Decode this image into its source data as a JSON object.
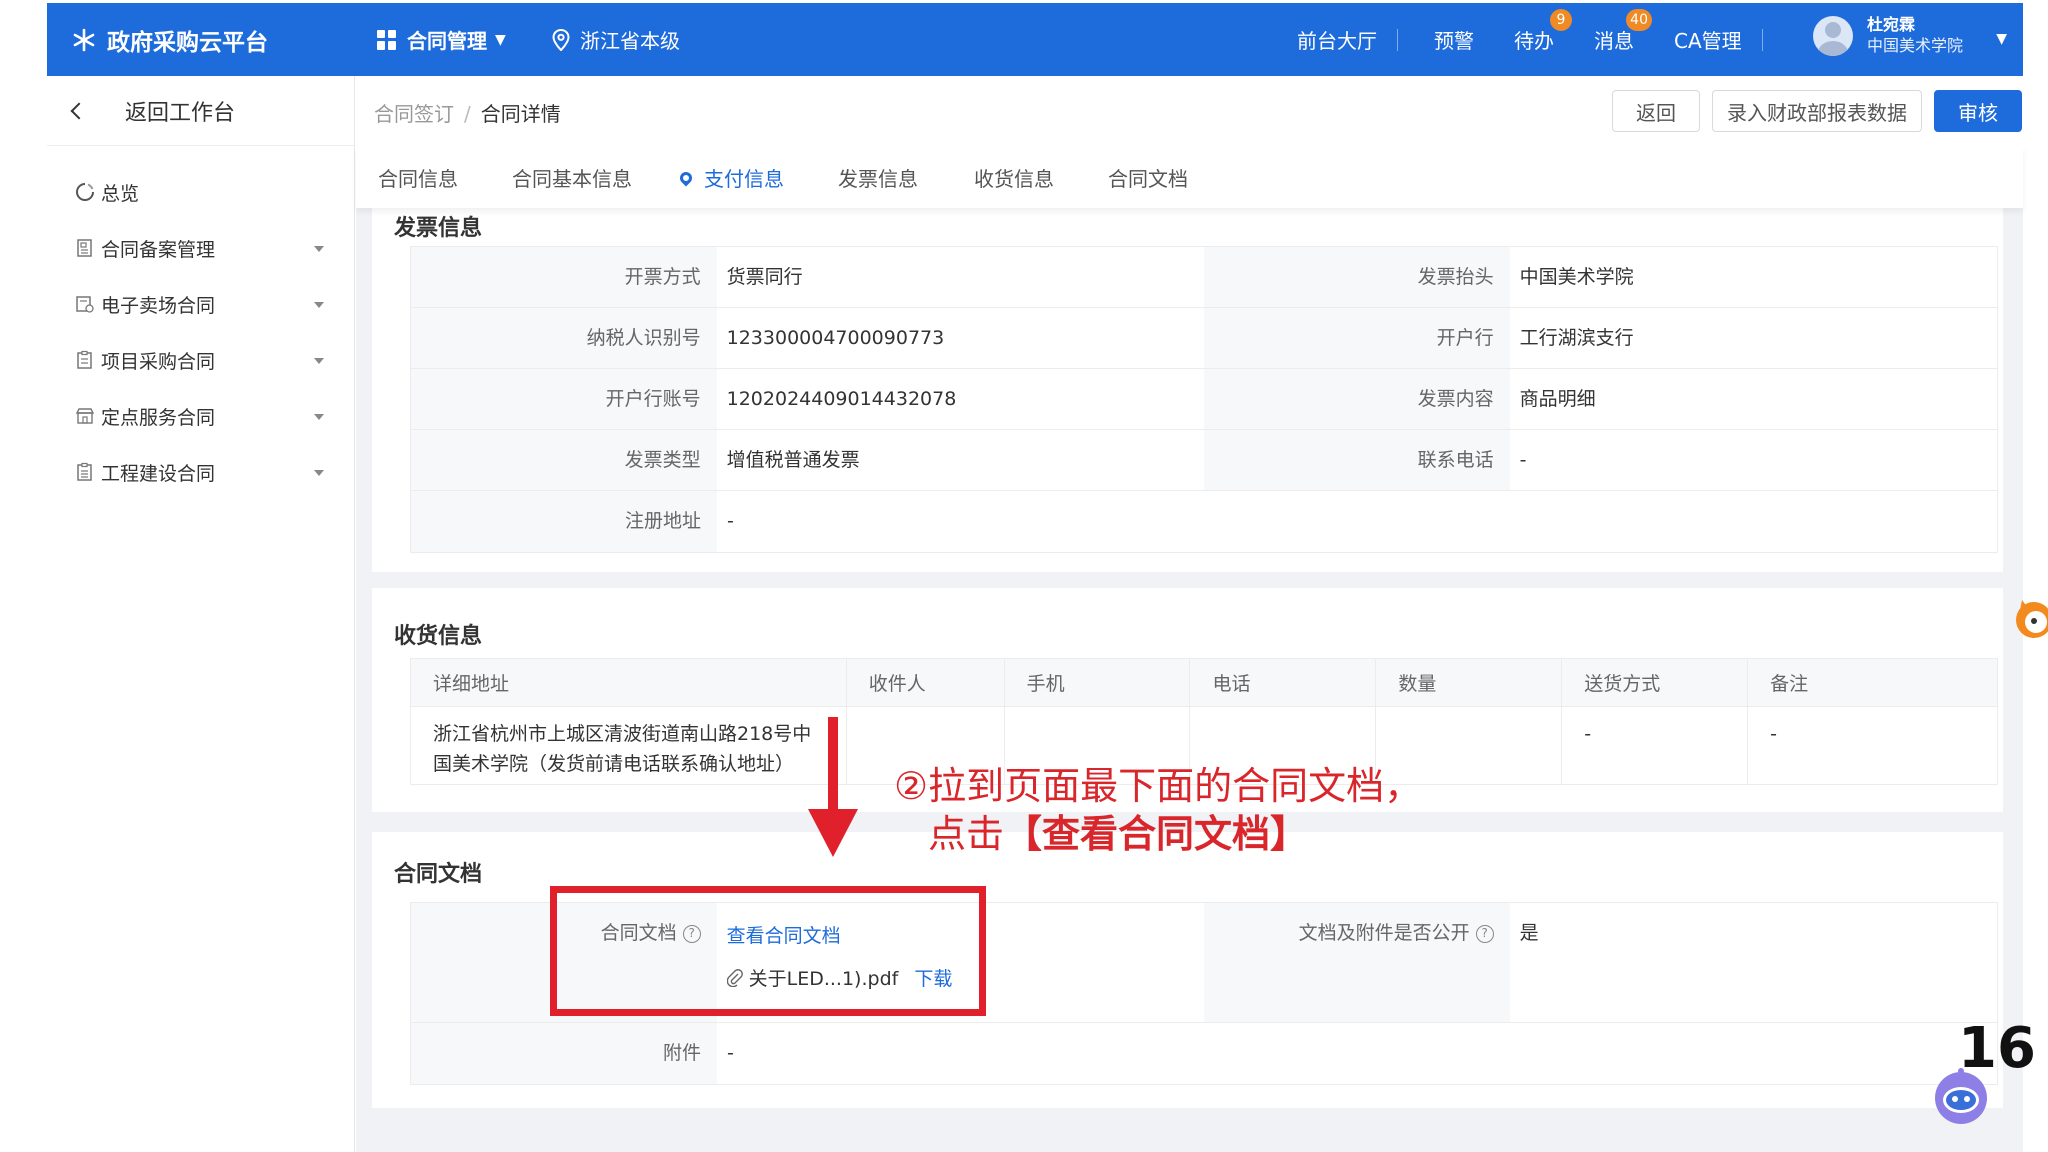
{
  "topbar": {
    "title": "政府采购云平台",
    "menu": "合同管理",
    "region": "浙江省本级",
    "nav": [
      {
        "label": "前台大厅",
        "badge": ""
      },
      {
        "label": "预警",
        "badge": ""
      },
      {
        "label": "待办",
        "badge": "9"
      },
      {
        "label": "消息",
        "badge": "40"
      },
      {
        "label": "CA管理",
        "badge": ""
      }
    ],
    "user_name": "杜宛霖",
    "user_org": "中国美术学院"
  },
  "sidebar": {
    "back": "返回工作台",
    "items": [
      {
        "label": "总览"
      },
      {
        "label": "合同备案管理"
      },
      {
        "label": "电子卖场合同"
      },
      {
        "label": "项目采购合同"
      },
      {
        "label": "定点服务合同"
      },
      {
        "label": "工程建设合同"
      }
    ]
  },
  "breadcrumb": {
    "parent": "合同签订",
    "sep": "/",
    "current": "合同详情"
  },
  "actions": {
    "back": "返回",
    "report": "录入财政部报表数据",
    "audit": "审核"
  },
  "tabs": [
    "合同信息",
    "合同基本信息",
    "支付信息",
    "发票信息",
    "收货信息",
    "合同文档"
  ],
  "invoice": {
    "title": "发票信息",
    "rows": [
      {
        "l1": "开票方式",
        "v1": "货票同行",
        "l2": "发票抬头",
        "v2": "中国美术学院"
      },
      {
        "l1": "纳税人识别号",
        "v1": "123300004700090773",
        "l2": "开户行",
        "v2": "工行湖滨支行"
      },
      {
        "l1": "开户行账号",
        "v1": "1202024409014432078",
        "l2": "发票内容",
        "v2": "商品明细"
      },
      {
        "l1": "发票类型",
        "v1": "增值税普通发票",
        "l2": "联系电话",
        "v2": "-"
      },
      {
        "l1": "注册地址",
        "v1": "-"
      }
    ]
  },
  "delivery": {
    "title": "收货信息",
    "headers": [
      "详细地址",
      "收件人",
      "手机",
      "电话",
      "数量",
      "送货方式",
      "备注"
    ],
    "row": {
      "address": "浙江省杭州市上城区清波街道南山路218号中国美术学院（发货前请电话联系确认地址）",
      "recipient": "",
      "mobile": "",
      "phone": "",
      "qty": "",
      "method": "-",
      "note": "-"
    }
  },
  "docs": {
    "title": "合同文档",
    "label": "合同文档",
    "view_link": "查看合同文档",
    "file": "关于LED...1).pdf",
    "download": "下载",
    "public_label": "文档及附件是否公开",
    "public_value": "是",
    "attach_label": "附件",
    "attach_value": "-"
  },
  "annotation": {
    "line1": "②拉到页面最下面的合同文档，",
    "line2_prefix": "点击",
    "line2_bold": "【查看合同文档】"
  },
  "page_number": "16",
  "colors": {
    "primary": "#1e6bdb",
    "annotation": "#e0202a",
    "badge": "#f08a24"
  }
}
